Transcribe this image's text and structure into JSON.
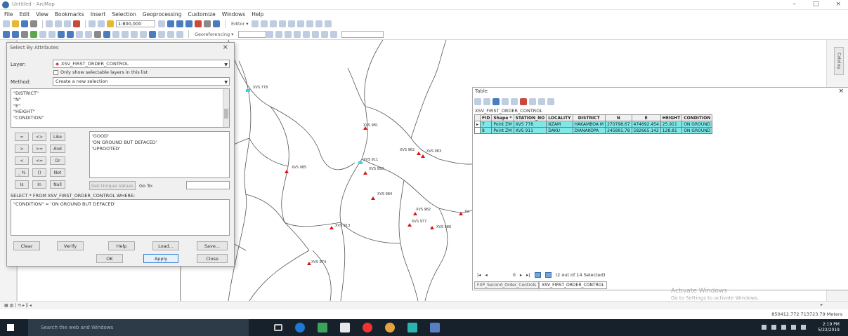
{
  "window": {
    "title": "Untitled - ArcMap",
    "min": "–",
    "max": "□",
    "close": "×"
  },
  "menu": [
    "File",
    "Edit",
    "View",
    "Bookmarks",
    "Insert",
    "Selection",
    "Geoprocessing",
    "Customize",
    "Windows",
    "Help"
  ],
  "toolbar": {
    "scale": "1:800,000",
    "editor": "Editor ▾",
    "georeferencing": "Georeferencing ▾"
  },
  "dialog": {
    "title": "Select By Attributes",
    "close": "×",
    "layer_label": "Layer:",
    "layer_value": "XSV_FIRST_ORDER_CONTROL",
    "only_selectable": "Only show selectable layers in this list",
    "method_label": "Method:",
    "method_value": "Create a new selection",
    "fields": [
      "\"DISTRICT\"",
      "\"N\"",
      "\"E\"",
      "\"HEIGHT\"",
      "\"CONDITION\""
    ],
    "operators": [
      [
        "=",
        "<>",
        "Like"
      ],
      [
        ">",
        ">=",
        "And"
      ],
      [
        "<",
        "<=",
        "Or"
      ],
      [
        "_ %",
        "()",
        "Not"
      ],
      [
        "Is",
        "In",
        "Null"
      ]
    ],
    "values": [
      "'GOOD'",
      "'ON GROUND BUT DEFACED'",
      "'UPROOTED'"
    ],
    "get_unique": "Get Unique Values",
    "go_to": "Go To:",
    "sql_header": "SELECT * FROM XSV_FIRST_ORDER_CONTROL WHERE:",
    "sql_text": "\"CONDITION\" = 'ON GROUND BUT DEFACED'",
    "buttons": {
      "clear": "Clear",
      "verify": "Verify",
      "help": "Help",
      "load": "Load...",
      "save": "Save...",
      "ok": "OK",
      "apply": "Apply",
      "close": "Close"
    }
  },
  "map": {
    "points": [
      {
        "label": "XVS 778",
        "color": "cyan"
      },
      {
        "label": "XVS 981",
        "color": "red"
      },
      {
        "label": "XVS 962",
        "color": "red"
      },
      {
        "label": "XVS 983",
        "color": "red"
      },
      {
        "label": "XVS 911",
        "color": "cyan"
      },
      {
        "label": "XVS 985",
        "color": "red"
      },
      {
        "label": "XVS 958",
        "color": "red"
      },
      {
        "label": "XVS 984",
        "color": "red"
      },
      {
        "label": "XVS 982",
        "color": "red"
      },
      {
        "label": "XVS 977",
        "color": "red"
      },
      {
        "label": "XVS 986",
        "color": "red"
      },
      {
        "label": "XVS 913",
        "color": "red"
      },
      {
        "label": "XVS 974",
        "color": "red"
      },
      {
        "label": "XV",
        "color": "red"
      }
    ]
  },
  "table": {
    "title": "Table",
    "close": "×",
    "layer_name": "XSV_FIRST_ORDER_CONTROL",
    "columns": [
      "FID",
      "Shape *",
      "STATION_NO",
      "LOCALITY",
      "DISTRICT",
      "N",
      "E",
      "HEIGHT",
      "CONDITION"
    ],
    "rows": [
      [
        "7",
        "Point ZM",
        "XVS 778",
        "NZAM",
        "HAKAMBOA M",
        "270798.67",
        "474692.454",
        "25.911",
        "ON GROUND"
      ],
      [
        "8",
        "Point ZM",
        "XVS 911",
        "DAKU",
        "DIANAKOPA",
        "245891.78",
        "582665.142",
        "128.81",
        "ON GROUND"
      ]
    ],
    "nav": {
      "page_start": "0",
      "of_label": "(2 out of 14 Selected)"
    },
    "tabs": [
      "FXP_Second_Order_Controls",
      "XSV_FIRST_ORDER_CONTROL"
    ]
  },
  "watermark": {
    "line1": "Activate Windows",
    "line2": "Go to Settings to activate Windows."
  },
  "status": {
    "coords": "850412.772  713723.79 Meters"
  },
  "taskbar": {
    "search": "Search the web and Windows",
    "time": "2:19 PM",
    "date": "5/22/2019"
  }
}
